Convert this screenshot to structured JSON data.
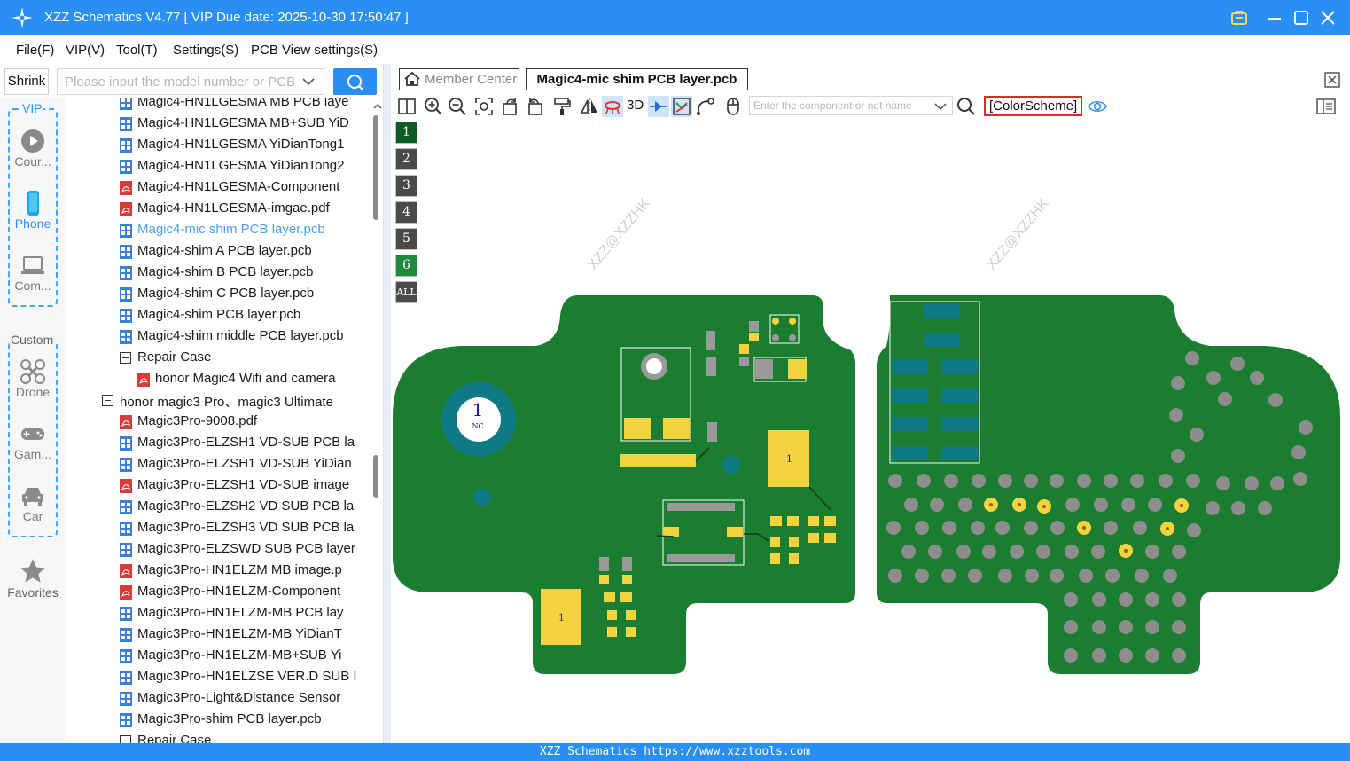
{
  "window": {
    "title": "XZZ Schematics V4.77 [ VIP Due date: 2025-10-30 17:50:47 ]"
  },
  "menu": [
    "File(F)",
    "VIP(V)",
    "Tool(T)",
    "Settings(S)",
    "PCB View settings(S)"
  ],
  "search": {
    "shrink_label": "Shrink",
    "placeholder": "Please input the model number or PCB"
  },
  "categories": {
    "vip_title": "VIP",
    "custom_title": "Custom",
    "items": [
      {
        "label": "Cour...",
        "icon": "play-circle-icon",
        "active": false
      },
      {
        "label": "Phone",
        "icon": "phone-icon",
        "active": true
      },
      {
        "label": "Com...",
        "icon": "laptop-icon",
        "active": false
      },
      {
        "label": "Drone",
        "icon": "drone-icon",
        "active": false
      },
      {
        "label": "Gam...",
        "icon": "gamepad-icon",
        "active": false
      },
      {
        "label": "Car",
        "icon": "car-icon",
        "active": false
      },
      {
        "label": "Favorites",
        "icon": "star-icon",
        "active": false
      }
    ]
  },
  "tree": [
    {
      "label": "Magic4-HN1LGESMA MB PCB laye",
      "type": "pcb",
      "indent": 1
    },
    {
      "label": "Magic4-HN1LGESMA MB+SUB YiD",
      "type": "pcb",
      "indent": 1
    },
    {
      "label": "Magic4-HN1LGESMA YiDianTong1",
      "type": "pcb",
      "indent": 1
    },
    {
      "label": "Magic4-HN1LGESMA YiDianTong2",
      "type": "pcb",
      "indent": 1
    },
    {
      "label": "Magic4-HN1LGESMA-Component",
      "type": "pdf",
      "indent": 1
    },
    {
      "label": "Magic4-HN1LGESMA-imgae.pdf",
      "type": "pdf",
      "indent": 1
    },
    {
      "label": "Magic4-mic shim PCB layer.pcb",
      "type": "pcb",
      "indent": 1,
      "selected": true
    },
    {
      "label": "Magic4-shim A PCB layer.pcb",
      "type": "pcb",
      "indent": 1
    },
    {
      "label": "Magic4-shim B PCB layer.pcb",
      "type": "pcb",
      "indent": 1
    },
    {
      "label": "Magic4-shim C PCB layer.pcb",
      "type": "pcb",
      "indent": 1
    },
    {
      "label": "Magic4-shim PCB layer.pcb",
      "type": "pcb",
      "indent": 1
    },
    {
      "label": "Magic4-shim middle PCB layer.pcb",
      "type": "pcb",
      "indent": 1
    },
    {
      "label": "Repair Case",
      "type": "folder",
      "indent": 1
    },
    {
      "label": "honor Magic4 Wifi and camera",
      "type": "pdf",
      "indent": 2
    },
    {
      "label": "honor magic3 Pro、magic3 Ultimate",
      "type": "folder",
      "indent": 0
    },
    {
      "label": "Magic3Pro-9008.pdf",
      "type": "pdf",
      "indent": 1
    },
    {
      "label": "Magic3Pro-ELZSH1 VD-SUB PCB la",
      "type": "pcb",
      "indent": 1
    },
    {
      "label": "Magic3Pro-ELZSH1 VD-SUB YiDian",
      "type": "pcb",
      "indent": 1
    },
    {
      "label": "Magic3Pro-ELZSH1 VD-SUB image",
      "type": "pdf",
      "indent": 1
    },
    {
      "label": "Magic3Pro-ELZSH2 VD SUB PCB la",
      "type": "pcb",
      "indent": 1
    },
    {
      "label": "Magic3Pro-ELZSH3 VD SUB PCB la",
      "type": "pcb",
      "indent": 1
    },
    {
      "label": "Magic3Pro-ELZSWD SUB PCB layer",
      "type": "pcb",
      "indent": 1
    },
    {
      "label": "Magic3Pro-HN1ELZM MB image.p",
      "type": "pdf",
      "indent": 1
    },
    {
      "label": "Magic3Pro-HN1ELZM-Component",
      "type": "pdf",
      "indent": 1
    },
    {
      "label": "Magic3Pro-HN1ELZM-MB PCB lay",
      "type": "pcb",
      "indent": 1
    },
    {
      "label": "Magic3Pro-HN1ELZM-MB YiDianT",
      "type": "pcb",
      "indent": 1
    },
    {
      "label": "Magic3Pro-HN1ELZM-MB+SUB Yi",
      "type": "pcb",
      "indent": 1
    },
    {
      "label": "Magic3Pro-HN1ELZSE VER.D SUB I",
      "type": "pcb",
      "indent": 1
    },
    {
      "label": "Magic3Pro-Light&Distance Sensor",
      "type": "pcb",
      "indent": 1
    },
    {
      "label": "Magic3Pro-shim PCB layer.pcb",
      "type": "pcb",
      "indent": 1
    },
    {
      "label": "Repair Case",
      "type": "folder",
      "indent": 1
    }
  ],
  "tabs": {
    "member_center": "Member Center",
    "active_file": "Magic4-mic shim PCB layer.pcb"
  },
  "pcb_toolbar": {
    "three_d_label": "3D",
    "component_placeholder": "Enter the component or net name",
    "color_scheme_label": "[ColorScheme]"
  },
  "layers": [
    {
      "label": "1",
      "color": "#0d5c26"
    },
    {
      "label": "2",
      "color": "#4a4a4a"
    },
    {
      "label": "3",
      "color": "#4a4a4a"
    },
    {
      "label": "4",
      "color": "#4a4a4a"
    },
    {
      "label": "5",
      "color": "#4a4a4a"
    },
    {
      "label": "6",
      "color": "#1e8a3a"
    },
    {
      "label": "ALL",
      "color": "#4a4a4a"
    }
  ],
  "pcb": {
    "watermark": "XZZ@XZZHK",
    "board_color": "#1a7d2f",
    "pad_color": "#f5d33f",
    "teal_color": "#0f7a86",
    "ball_color": "#8d8d8d",
    "labels": {
      "pin_one": "1",
      "nc": "NC"
    }
  },
  "status": {
    "text": "XZZ Schematics https://www.xzztools.com"
  },
  "colors": {
    "accent": "#2a8ff4",
    "selected_text": "#4a9ff2"
  }
}
